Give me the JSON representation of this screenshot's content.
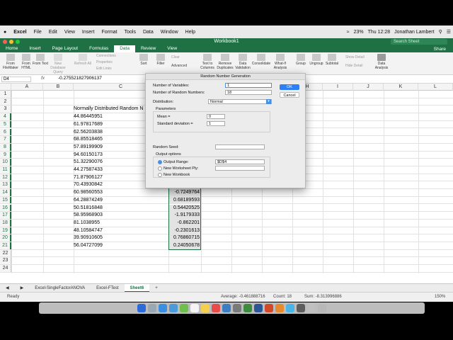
{
  "menubar": {
    "apple": "",
    "app_name": "Excel",
    "menus": [
      "File",
      "Edit",
      "View",
      "Insert",
      "Format",
      "Tools",
      "Data",
      "Window",
      "Help"
    ],
    "battery": "23%",
    "clock": "Thu 12:28",
    "user": "Jonathan Lambert"
  },
  "window": {
    "title": "Workbook1",
    "search_placeholder": "Search Sheet"
  },
  "ribbon_tabs": [
    "Home",
    "Insert",
    "Page Layout",
    "Formulas",
    "Data",
    "Review",
    "View"
  ],
  "active_tab": "Data",
  "share_label": "Share",
  "ribbon": {
    "from_filemaker": "From FileMaker",
    "from_html": "From HTML",
    "from_text": "From Text",
    "new_db_query": "New Database Query",
    "refresh_all": "Refresh All",
    "connections": "Connections",
    "properties": "Properties",
    "edit_links": "Edit Links",
    "sort": "Sort",
    "filter": "Filter",
    "clear": "Clear",
    "advanced": "Advanced",
    "text_to_columns": "Text to Columns",
    "remove_duplicates": "Remove Duplicates",
    "data_validation": "Data Validation",
    "consolidate": "Consolidate",
    "what_if": "What-If Analysis",
    "group": "Group",
    "ungroup": "Ungroup",
    "subtotal": "Subtotal",
    "show_detail": "Show Detail",
    "hide_detail": "Hide Detail",
    "data_analysis": "Data Analysis"
  },
  "formula_bar": {
    "name_box": "D4",
    "fx": "fx",
    "value": "-0.275521827906137"
  },
  "columns": [
    "A",
    "B",
    "C",
    "D",
    "E",
    "F",
    "G",
    "H",
    "I",
    "J",
    "K",
    "L"
  ],
  "rows": [
    {
      "n": "1",
      "b": "",
      "d": ""
    },
    {
      "n": "2",
      "b": "",
      "d": ""
    },
    {
      "n": "3",
      "b": "Normally Distributed Random N",
      "d": ""
    },
    {
      "n": "4",
      "b": "44.86445951",
      "d": ""
    },
    {
      "n": "5",
      "b": "61.97817689",
      "d": ""
    },
    {
      "n": "6",
      "b": "62.56203838",
      "d": ""
    },
    {
      "n": "7",
      "b": "68.85518465",
      "d": ""
    },
    {
      "n": "8",
      "b": "57.89199909",
      "d": ""
    },
    {
      "n": "9",
      "b": "94.60150173",
      "d": ""
    },
    {
      "n": "10",
      "b": "51.32290076",
      "d": ""
    },
    {
      "n": "11",
      "b": "44.27587433",
      "d": ""
    },
    {
      "n": "12",
      "b": "71.87906127",
      "d": ""
    },
    {
      "n": "13",
      "b": "70.43930842",
      "d": ""
    },
    {
      "n": "14",
      "b": "60.98560553",
      "d": "-0.7249764"
    },
    {
      "n": "15",
      "b": "64.28874249",
      "d": "0.68189593"
    },
    {
      "n": "16",
      "b": "50.51816848",
      "d": "0.54420525"
    },
    {
      "n": "17",
      "b": "58.95968903",
      "d": "-1.9179333"
    },
    {
      "n": "18",
      "b": "81.1038955",
      "d": "-0.862201"
    },
    {
      "n": "19",
      "b": "48.10584747",
      "d": "-0.2301613"
    },
    {
      "n": "20",
      "b": "39.90910605",
      "d": "0.76860715"
    },
    {
      "n": "21",
      "b": "56.04727099",
      "d": "0.24050678"
    },
    {
      "n": "22",
      "b": "",
      "d": ""
    },
    {
      "n": "23",
      "b": "",
      "d": ""
    },
    {
      "n": "24",
      "b": "",
      "d": ""
    }
  ],
  "sheet_tabs": [
    "Excel-SingleFactorANOVA",
    "Excel-FTest",
    "Sheet6"
  ],
  "active_sheet": "Sheet6",
  "status": {
    "ready": "Ready",
    "average": "Average: -0.461888716",
    "count": "Count: 18",
    "sum": "Sum: -8.313996886",
    "zoom": "150%"
  },
  "dialog": {
    "title": "Random Number Generation",
    "num_vars_label": "Number of Variables:",
    "num_vars_value": "1",
    "num_random_label": "Number of Random Numbers:",
    "num_random_value": "18",
    "distribution_label": "Distribution:",
    "distribution_value": "Normal",
    "parameters_label": "Parameters",
    "mean_label": "Mean =",
    "mean_value": "0",
    "stddev_label": "Standard deviation =",
    "stddev_value": "1",
    "seed_label": "Random Seed:",
    "seed_value": "",
    "output_label": "Output options",
    "output_range_label": "Output Range:",
    "output_range_value": "$D$4",
    "new_ws_label": "New Worksheet Ply:",
    "new_wb_label": "New Workbook",
    "ok": "OK",
    "cancel": "Cancel"
  },
  "colors": {
    "excel_green": "#1f7145",
    "ok_blue": "#2e7ff3"
  }
}
